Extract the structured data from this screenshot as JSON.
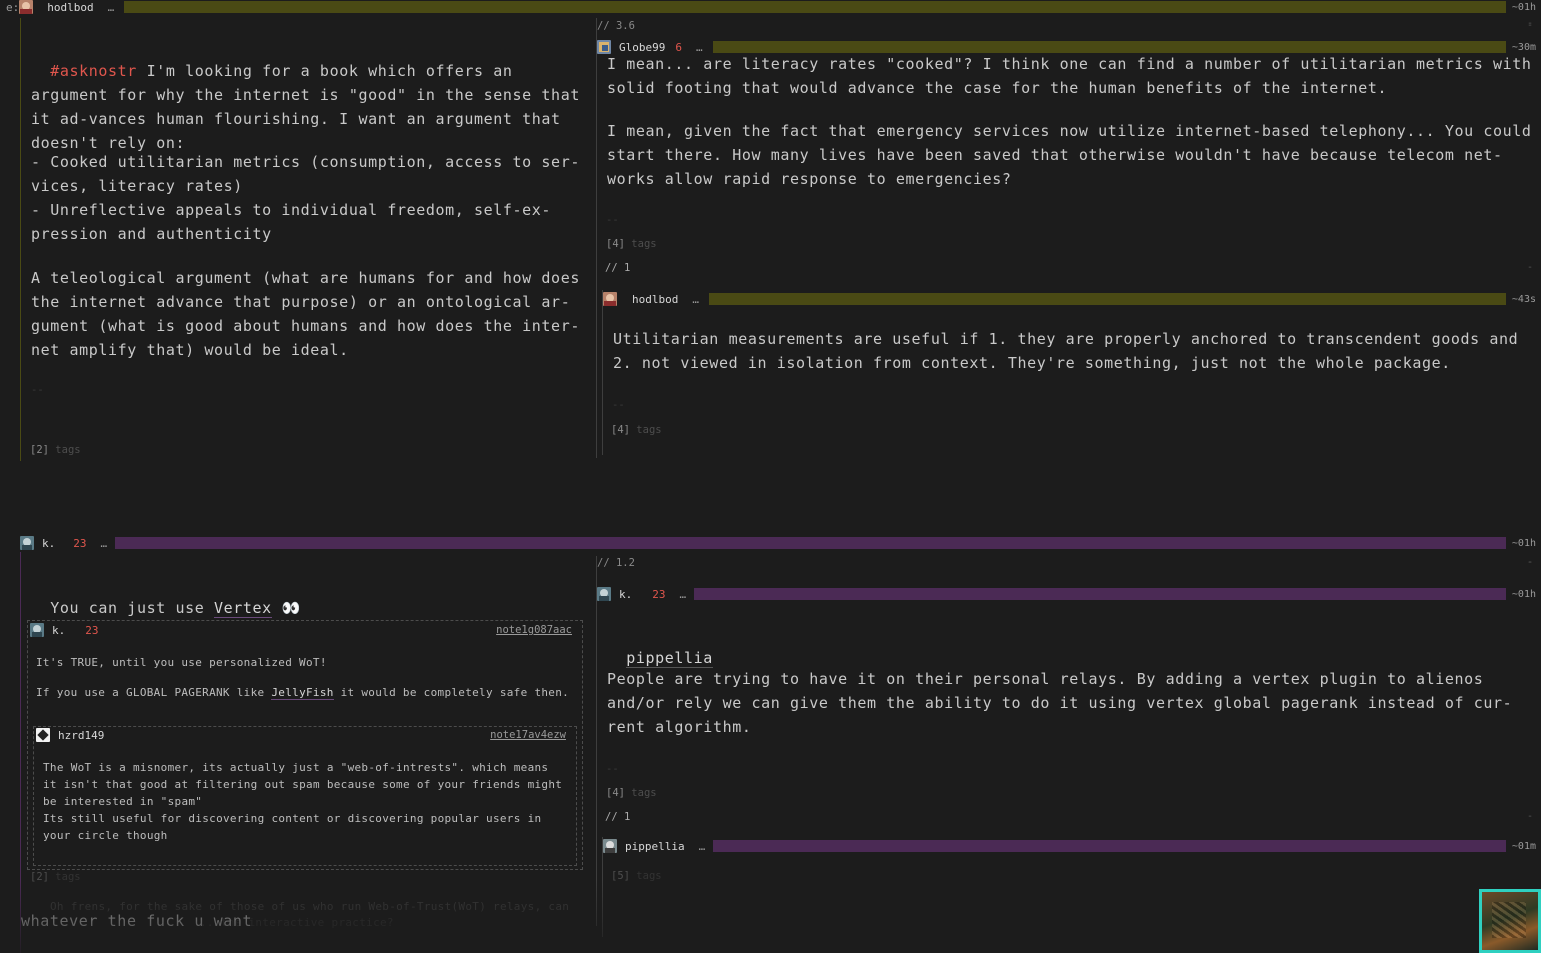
{
  "colors": {
    "olive": "#4a4a14",
    "purple": "#4b2a55",
    "accent_red": "#e0564d",
    "thumb_border": "#2fd0c0"
  },
  "top_header": {
    "prefix": "e:",
    "author": "hodlbod",
    "dots": "…",
    "age": "~01h",
    "dash": "-"
  },
  "post1": {
    "hashtag": "#asknostr",
    "paragraphs": [
      " I'm looking for a book which offers an argument for why the internet is \"good\" in the sense that it ad-vances human flourishing. I want an argument that doesn't rely on:",
      "- Cooked utilitarian metrics (consumption, access to ser-vices, literacy rates)\n- Unreflective appeals to individual freedom, self-ex-pression and authenticity",
      "A teleological argument (what are humans for and how does the internet advance that purpose) or an ontological ar-gument (what is good about humans and how does the inter-net amplify that) would be ideal."
    ],
    "sep": "--",
    "tags_count": "[2]",
    "tags_label": "tags"
  },
  "thread1": {
    "score": "// 3.6",
    "score_dash": "-",
    "reply1": {
      "author": "Globe99",
      "count": "6",
      "dots": "…",
      "age": "~30m",
      "p1": "I mean... are literacy rates \"cooked\"? I think one can find a number of utilitarian metrics with solid footing that would advance the case for the human benefits of the internet.",
      "p2": "I mean, given the fact that emergency services now utilize internet-based telephony... You could start there. How many lives have been saved that otherwise wouldn't have because telecom net-works allow rapid response to emergencies?",
      "sep": "--",
      "tags_count": "[4]",
      "tags_label": "tags",
      "replies": "// 1",
      "replies_dash": "-"
    },
    "reply2": {
      "author": "hodlbod",
      "dots": "…",
      "age": "~43s",
      "p1": "Utilitarian measurements are useful if 1. they are properly anchored to transcendent goods and 2. not viewed in isolation from context. They're something, just not the whole package.",
      "sep": "--",
      "tags_count": "[4]",
      "tags_label": "tags"
    }
  },
  "post2_header": {
    "author": "k.",
    "count": "23",
    "dots": "…",
    "age": "~01h",
    "dash": "-"
  },
  "post2": {
    "text_before": "You can just use ",
    "link_text": "Vertex",
    "emoji": "👀",
    "quote1": {
      "author": "k.",
      "count": "23",
      "note_id": "note1g087aac",
      "line1": "It's TRUE, until you use personalized WoT!",
      "line2_before": "If you use a GLOBAL PAGERANK like ",
      "line2_link": "JellyFish",
      "line2_after": " it would be completely safe then.",
      "quote2": {
        "author": "hzrd149",
        "note_id": "note17av4ezw",
        "text": "The WoT is a misnomer, its actually just a \"web-of-intrests\". which means it isn't that good at filtering out spam because some of your friends might be interested in \"spam\"\nIts still useful for discovering content or discovering popular users in your circle though"
      }
    },
    "tags_count": "[2]",
    "tags_label": "tags",
    "faded_line": "Oh frens, for the sake of those of us who run Web-of-Trust(WoT) relays, can",
    "overlay_text": "whatever the fuck u want",
    "faded_line2": "...the interactive practice?"
  },
  "thread2": {
    "score": "// 1.2",
    "score_dash": "-",
    "reply1": {
      "author": "k.",
      "count": "23",
      "dots": "…",
      "age": "~01h",
      "mention": "pippellia",
      "p1": "People are trying to have it on their personal relays. By adding a vertex plugin to alienos and/or rely we can give them the ability to do it using vertex global pagerank instead of cur-rent algorithm.",
      "sep": "--",
      "tags_count": "[4]",
      "tags_label": "tags",
      "replies": "// 1",
      "replies_dash": "-"
    },
    "reply2": {
      "author": "pippellia",
      "dots": "…",
      "age": "~01m",
      "tags_count": "[5]",
      "tags_label": "tags"
    }
  }
}
